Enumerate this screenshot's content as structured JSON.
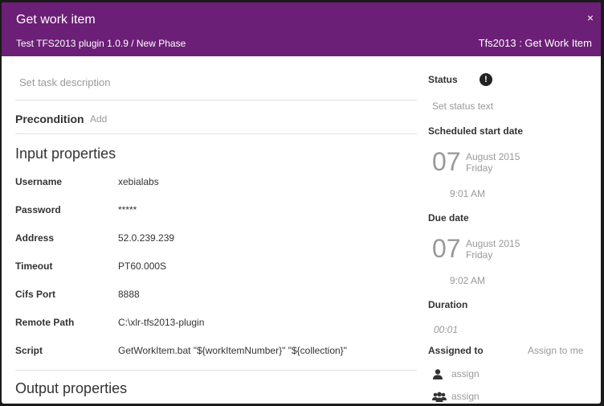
{
  "header": {
    "title": "Get work item",
    "close_label": "×",
    "breadcrumb": "Test TFS2013 plugin 1.0.9 / New Phase",
    "task_type": "Tfs2013 : Get Work Item"
  },
  "left": {
    "description_placeholder": "Set task description",
    "precondition_label": "Precondition",
    "precondition_add": "Add",
    "input_title": "Input properties",
    "output_title": "Output properties",
    "properties": [
      {
        "label": "Username",
        "value": "xebialabs"
      },
      {
        "label": "Password",
        "value": "*****"
      },
      {
        "label": "Address",
        "value": "52.0.239.239"
      },
      {
        "label": "Timeout",
        "value": "PT60.000S"
      },
      {
        "label": "Cifs Port",
        "value": "8888"
      },
      {
        "label": "Remote Path",
        "value": "C:\\xlr-tfs2013-plugin"
      },
      {
        "label": "Script",
        "value": "GetWorkItem.bat \"${workItemNumber}\" \"${collection}\""
      }
    ]
  },
  "right": {
    "status_label": "Status",
    "status_icon": "exclamation-icon",
    "status_placeholder": "Set status text",
    "scheduled_label": "Scheduled start date",
    "scheduled": {
      "day": "07",
      "month_year": "August 2015",
      "weekday": "Friday",
      "time": "9:01 AM"
    },
    "due_label": "Due date",
    "due": {
      "day": "07",
      "month_year": "August 2015",
      "weekday": "Friday",
      "time": "9:02 AM"
    },
    "duration_label": "Duration",
    "duration_value": "00:01",
    "assigned_label": "Assigned to",
    "assign_to_me": "Assign to me",
    "assign_user": "assign",
    "assign_team": "assign"
  },
  "colors": {
    "header": "#6c1f76",
    "muted_text": "#999999",
    "text": "#333333"
  }
}
